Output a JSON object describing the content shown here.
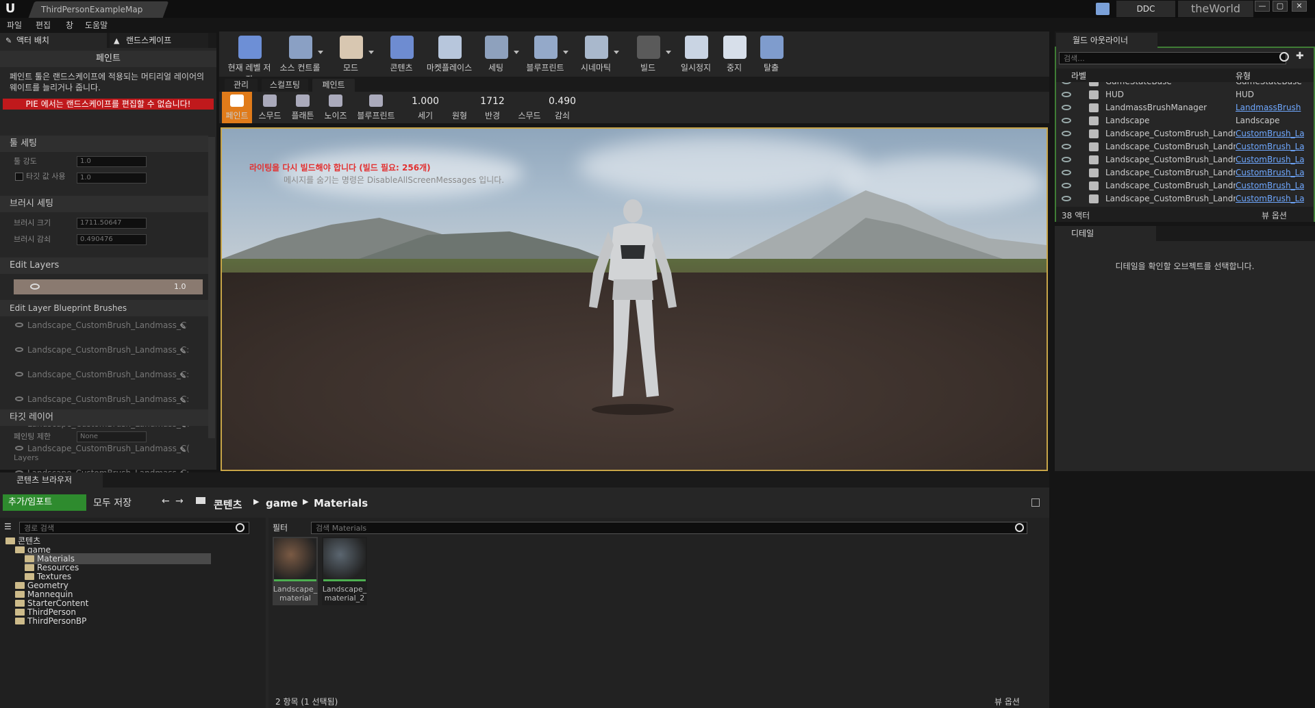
{
  "window": {
    "map_tab": "ThirdPersonExampleMap",
    "ddc_label": "DDC",
    "world_label": "theWorld",
    "minimize": "—",
    "maximize": "▢",
    "close": "✕"
  },
  "menu": [
    "파일",
    "편집",
    "창",
    "도움말"
  ],
  "left_tabs": {
    "place_actors": "액터 배치",
    "landscape": "랜드스케이프"
  },
  "left_panel": {
    "mode_title": "페인트",
    "description": "페인트 툴은 랜드스케이프에 적용되는 머티리얼 레이어의 웨이트를 늘리거나 줍니다.",
    "pie_warning": "PIE 에서는 랜드스케이프를 편집할 수 없습니다!",
    "tool_settings": "툴 세팅",
    "tool_strength_label": "툴 강도",
    "tool_strength": "1.0",
    "target_value_label": "타깃 값 사용",
    "target_value": "1.0",
    "brush_settings": "브러시 세팅",
    "brush_size_label": "브러시 크기",
    "brush_size": "1711.50647",
    "brush_falloff_label": "브러시 감쇠",
    "brush_falloff": "0.490476",
    "edit_layers": "Edit Layers",
    "edit_layer_value": "1.0",
    "edit_layer_bp_brushes": "Edit Layer Blueprint Brushes",
    "brushes": [
      "Landscape_CustomBrush_Landmass_C",
      "Landscape_CustomBrush_Landmass_C:",
      "Landscape_CustomBrush_Landmass_C:",
      "Landscape_CustomBrush_Landmass_C:",
      "Landscape_CustomBrush_Landmass_C!",
      "Landscape_CustomBrush_Landmass_C(",
      "Landscape_CustomBrush_Landmass_C:"
    ],
    "target_layer": "타깃 레이어",
    "paint_restriction_label": "페인팅 제한",
    "paint_restriction": "None",
    "layers_label": "Layers"
  },
  "toolbar": [
    {
      "label": "현재 레벨 저장",
      "color": "#6d8fd6"
    },
    {
      "label": "소스 컨트롤",
      "color": "#8aa0c4"
    },
    {
      "label": "모드",
      "color": "#d8c7b1"
    },
    {
      "label": "콘텐츠",
      "color": "#6e8cd1"
    },
    {
      "label": "마켓플레이스",
      "color": "#b7c6dc"
    },
    {
      "label": "세팅",
      "color": "#8ea1bd"
    },
    {
      "label": "블루프린트",
      "color": "#94a9c9"
    },
    {
      "label": "시네마틱",
      "color": "#a9b8cc"
    },
    {
      "label": "빌드",
      "color": "#5a5a5a"
    },
    {
      "label": "일시정지",
      "color": "#c9d4e3"
    },
    {
      "label": "중지",
      "color": "#d7dfea"
    },
    {
      "label": "탈출",
      "color": "#7f9ccd"
    }
  ],
  "subtabs": [
    "관리",
    "스컬프팅",
    "페인트"
  ],
  "paint_tools": [
    "페인트",
    "스무드",
    "플래튼",
    "노이즈",
    "블루프린트"
  ],
  "paint_params": [
    {
      "value": "1.000",
      "label": "세기"
    },
    {
      "value": "",
      "label": "원형"
    },
    {
      "value": "1712",
      "label": "반경"
    },
    {
      "value": "",
      "label": "스무드"
    },
    {
      "value": "0.490",
      "label": "감쇠"
    }
  ],
  "viewport": {
    "lighting_warning": "라이팅을 다시 빌드해야 합니다 (빌드 필요: 256개)",
    "hide_hint": "메시지를 숨기는 명령은 DisableAllScreenMessages 입니다."
  },
  "outliner": {
    "tab": "월드 아웃라이너",
    "search_placeholder": "검색...",
    "col_label": "라벨",
    "col_type": "유형",
    "rows": [
      {
        "name": "GameStateBase",
        "type": "GameStateBase",
        "link": false
      },
      {
        "name": "HUD",
        "type": "HUD",
        "link": false
      },
      {
        "name": "LandmassBrushManager",
        "type": "LandmassBrush",
        "link": true
      },
      {
        "name": "Landscape",
        "type": "Landscape",
        "link": false
      },
      {
        "name": "Landscape_CustomBrush_Landma",
        "type": "CustomBrush_La",
        "link": true
      },
      {
        "name": "Landscape_CustomBrush_Landma",
        "type": "CustomBrush_La",
        "link": true
      },
      {
        "name": "Landscape_CustomBrush_Landma",
        "type": "CustomBrush_La",
        "link": true
      },
      {
        "name": "Landscape_CustomBrush_Landma",
        "type": "CustomBrush_La",
        "link": true
      },
      {
        "name": "Landscape_CustomBrush_Landma",
        "type": "CustomBrush_La",
        "link": true
      },
      {
        "name": "Landscape_CustomBrush_Landma",
        "type": "CustomBrush_La",
        "link": true
      }
    ],
    "actor_count": "38 액터",
    "view_options": "뷰 옵션"
  },
  "details": {
    "tab": "디테일",
    "empty_hint": "디테일을 확인할 오브젝트를 선택합니다."
  },
  "content_browser": {
    "tab": "콘텐츠 브라우저",
    "add_import": "추가/임포트",
    "save_all": "모두 저장",
    "breadcrumb": [
      "콘텐츠",
      "game",
      "Materials"
    ],
    "path_search_placeholder": "경로 검색",
    "filter": "필터",
    "asset_search_placeholder": "검색 Materials",
    "tree": [
      {
        "label": "콘텐츠",
        "depth": 0,
        "selected": false
      },
      {
        "label": "game",
        "depth": 1,
        "selected": false
      },
      {
        "label": "Materials",
        "depth": 2,
        "selected": true
      },
      {
        "label": "Resources",
        "depth": 2,
        "selected": false
      },
      {
        "label": "Textures",
        "depth": 2,
        "selected": false
      },
      {
        "label": "Geometry",
        "depth": 1,
        "selected": false
      },
      {
        "label": "Mannequin",
        "depth": 1,
        "selected": false
      },
      {
        "label": "StarterContent",
        "depth": 1,
        "selected": false
      },
      {
        "label": "ThirdPerson",
        "depth": 1,
        "selected": false
      },
      {
        "label": "ThirdPersonBP",
        "depth": 1,
        "selected": false
      }
    ],
    "assets": [
      {
        "name": "Landscape_ material",
        "color": "#7a5a44"
      },
      {
        "name": "Landscape_ material_2",
        "color": "#5b6670"
      }
    ],
    "status": "2 항목 (1 선택됨)",
    "view_options": "뷰 옵션"
  }
}
